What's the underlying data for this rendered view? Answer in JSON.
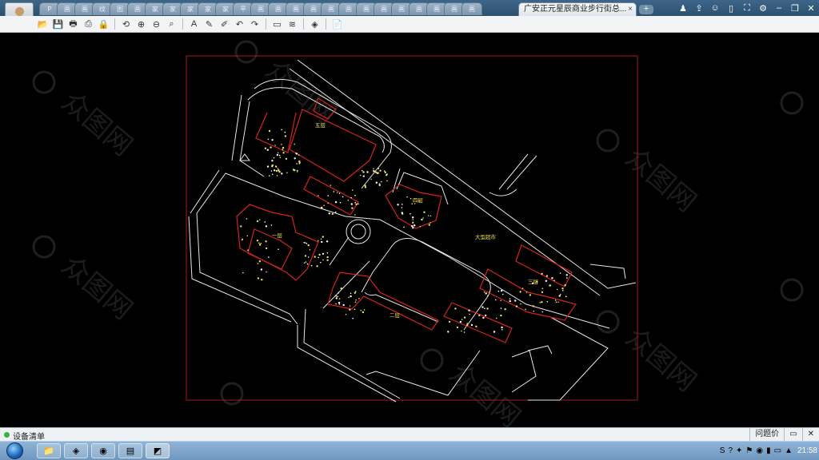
{
  "tabbar": {
    "tab_glyphs": [
      "P",
      "画",
      "画",
      "纹",
      "图",
      "画",
      "家",
      "家",
      "家",
      "家",
      "家",
      "平",
      "画",
      "画",
      "画",
      "画",
      "画",
      "画",
      "画",
      "画",
      "画",
      "画",
      "画",
      "画",
      "画"
    ],
    "active_tab": "广安正元星辰商业步行街总...",
    "close": "×",
    "new_tab": "+"
  },
  "window": {
    "icons": [
      "users-icon",
      "share-icon",
      "chat-icon",
      "phone-icon",
      "fullscreen-icon",
      "settings-icon",
      "minimize-icon",
      "restore-icon",
      "close-icon"
    ],
    "glyphs": [
      "♟",
      "⇪",
      "☺",
      "▯",
      "⛶",
      "⚙",
      "–",
      "❐",
      "✕"
    ]
  },
  "toolbar": {
    "buttons": [
      {
        "name": "open-icon",
        "glyph": "📂"
      },
      {
        "name": "save-icon",
        "glyph": "💾"
      },
      {
        "name": "print-icon",
        "glyph": "🖶"
      },
      {
        "name": "export-pdf-icon",
        "glyph": "⎙"
      },
      {
        "name": "lock-icon",
        "glyph": "🔒"
      },
      {
        "name": "sep"
      },
      {
        "name": "rotate-icon",
        "glyph": "⟲"
      },
      {
        "name": "zoom-window-icon",
        "glyph": "⊕"
      },
      {
        "name": "zoom-out-icon",
        "glyph": "⊖"
      },
      {
        "name": "zoom-extents-icon",
        "glyph": "⌕"
      },
      {
        "name": "sep"
      },
      {
        "name": "text-icon",
        "glyph": "A"
      },
      {
        "name": "pencil-icon",
        "glyph": "✎"
      },
      {
        "name": "marker-icon",
        "glyph": "✐"
      },
      {
        "name": "undo-icon",
        "glyph": "↶"
      },
      {
        "name": "redo-icon",
        "glyph": "↷"
      },
      {
        "name": "sep"
      },
      {
        "name": "measure-icon",
        "glyph": "▭"
      },
      {
        "name": "dimension-icon",
        "glyph": "≋"
      },
      {
        "name": "sep"
      },
      {
        "name": "layers-icon",
        "glyph": "◈"
      },
      {
        "name": "sep"
      },
      {
        "name": "properties-icon",
        "glyph": "📄"
      }
    ]
  },
  "drawing": {
    "labels": {
      "block_a": "五层",
      "block_b": "一层",
      "block_c": "四层",
      "block_d": "二层",
      "block_e": "三层",
      "plaza": "大型超市"
    }
  },
  "watermark": {
    "text": "众图网"
  },
  "statusbar": {
    "left": "设备清单",
    "right_1": "问题价",
    "right_2": "▭",
    "right_3": "✕"
  },
  "taskbar": {
    "clock": "21:58",
    "tray": [
      "S",
      "?",
      "✦",
      "⚑",
      "◉",
      "▮",
      "▭",
      "▲"
    ]
  }
}
